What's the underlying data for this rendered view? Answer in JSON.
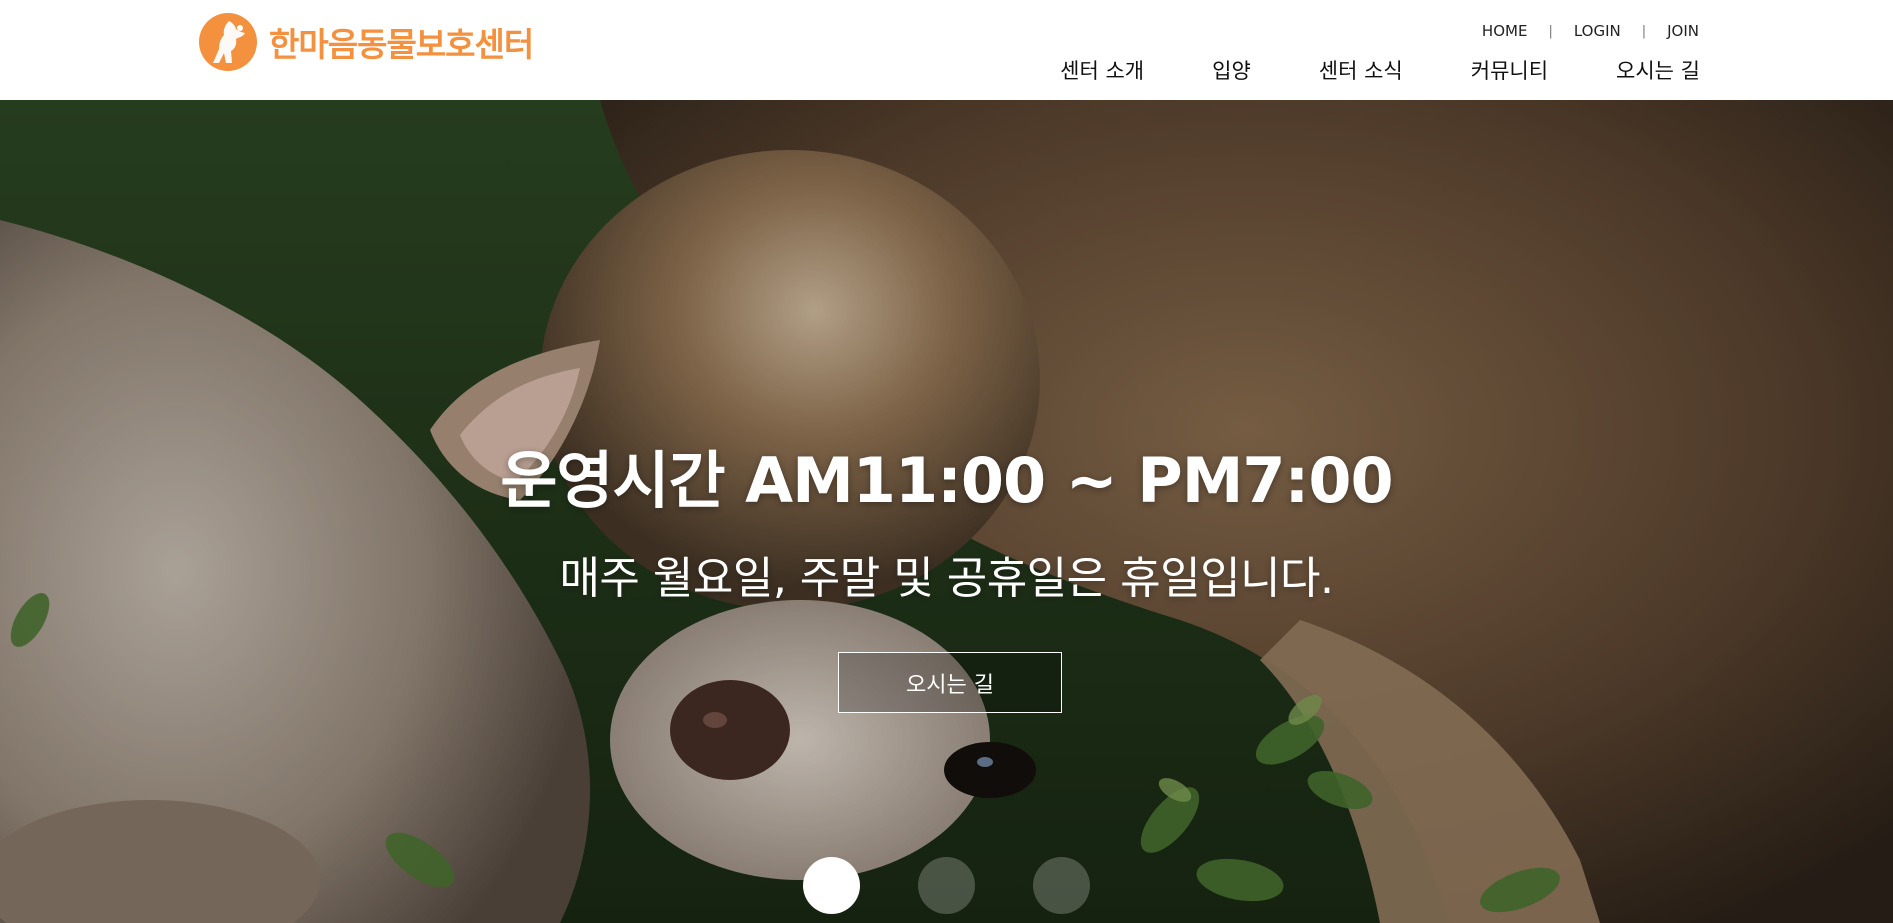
{
  "header": {
    "logo_text": "한마음동물보호센터",
    "brand_color": "#f4913f",
    "util_nav": {
      "home": "HOME",
      "login": "LOGIN",
      "join": "JOIN",
      "separator": "|"
    },
    "main_nav": [
      {
        "label": "센터 소개"
      },
      {
        "label": "입양"
      },
      {
        "label": "센터 소식"
      },
      {
        "label": "커뮤니티"
      },
      {
        "label": "오시는 길"
      }
    ]
  },
  "hero": {
    "title": "운영시간 AM11:00 ~ PM7:00",
    "subtitle": "매주 월요일, 주말 및 공휴일은 휴일입니다.",
    "button_label": "오시는 길",
    "slide_count": 3,
    "active_slide": 1
  }
}
